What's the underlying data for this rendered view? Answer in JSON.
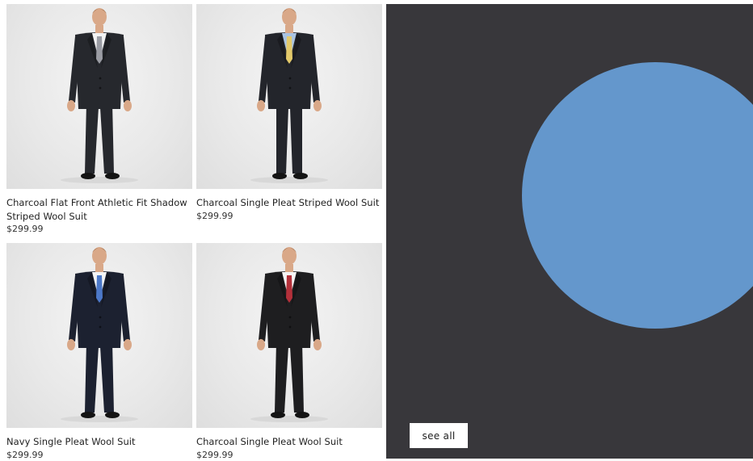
{
  "products": [
    {
      "title": "Charcoal Flat Front Athletic Fit Shadow Striped Wool Suit",
      "price": "$299.99",
      "suit_color": "#26282d",
      "tie_color": "#9a9ca3",
      "shirt_color": "#f2f2f2"
    },
    {
      "title": "Charcoal Single Pleat Striped Wool Suit",
      "price": "$299.99",
      "suit_color": "#23252b",
      "tie_color": "#e3c96a",
      "shirt_color": "#a9c3e2"
    },
    {
      "title": "Navy Single Pleat Wool Suit",
      "price": "$299.99",
      "suit_color": "#1c2130",
      "tie_color": "#4c78c8",
      "shirt_color": "#f4f4f4"
    },
    {
      "title": "Charcoal Single Pleat Wool Suit",
      "price": "$299.99",
      "suit_color": "#1e1e20",
      "tie_color": "#b3303a",
      "shirt_color": "#f4f4f4"
    }
  ],
  "promo": {
    "background": "#38373b",
    "circle_color": "#6497cc",
    "see_all_label": "see all"
  }
}
